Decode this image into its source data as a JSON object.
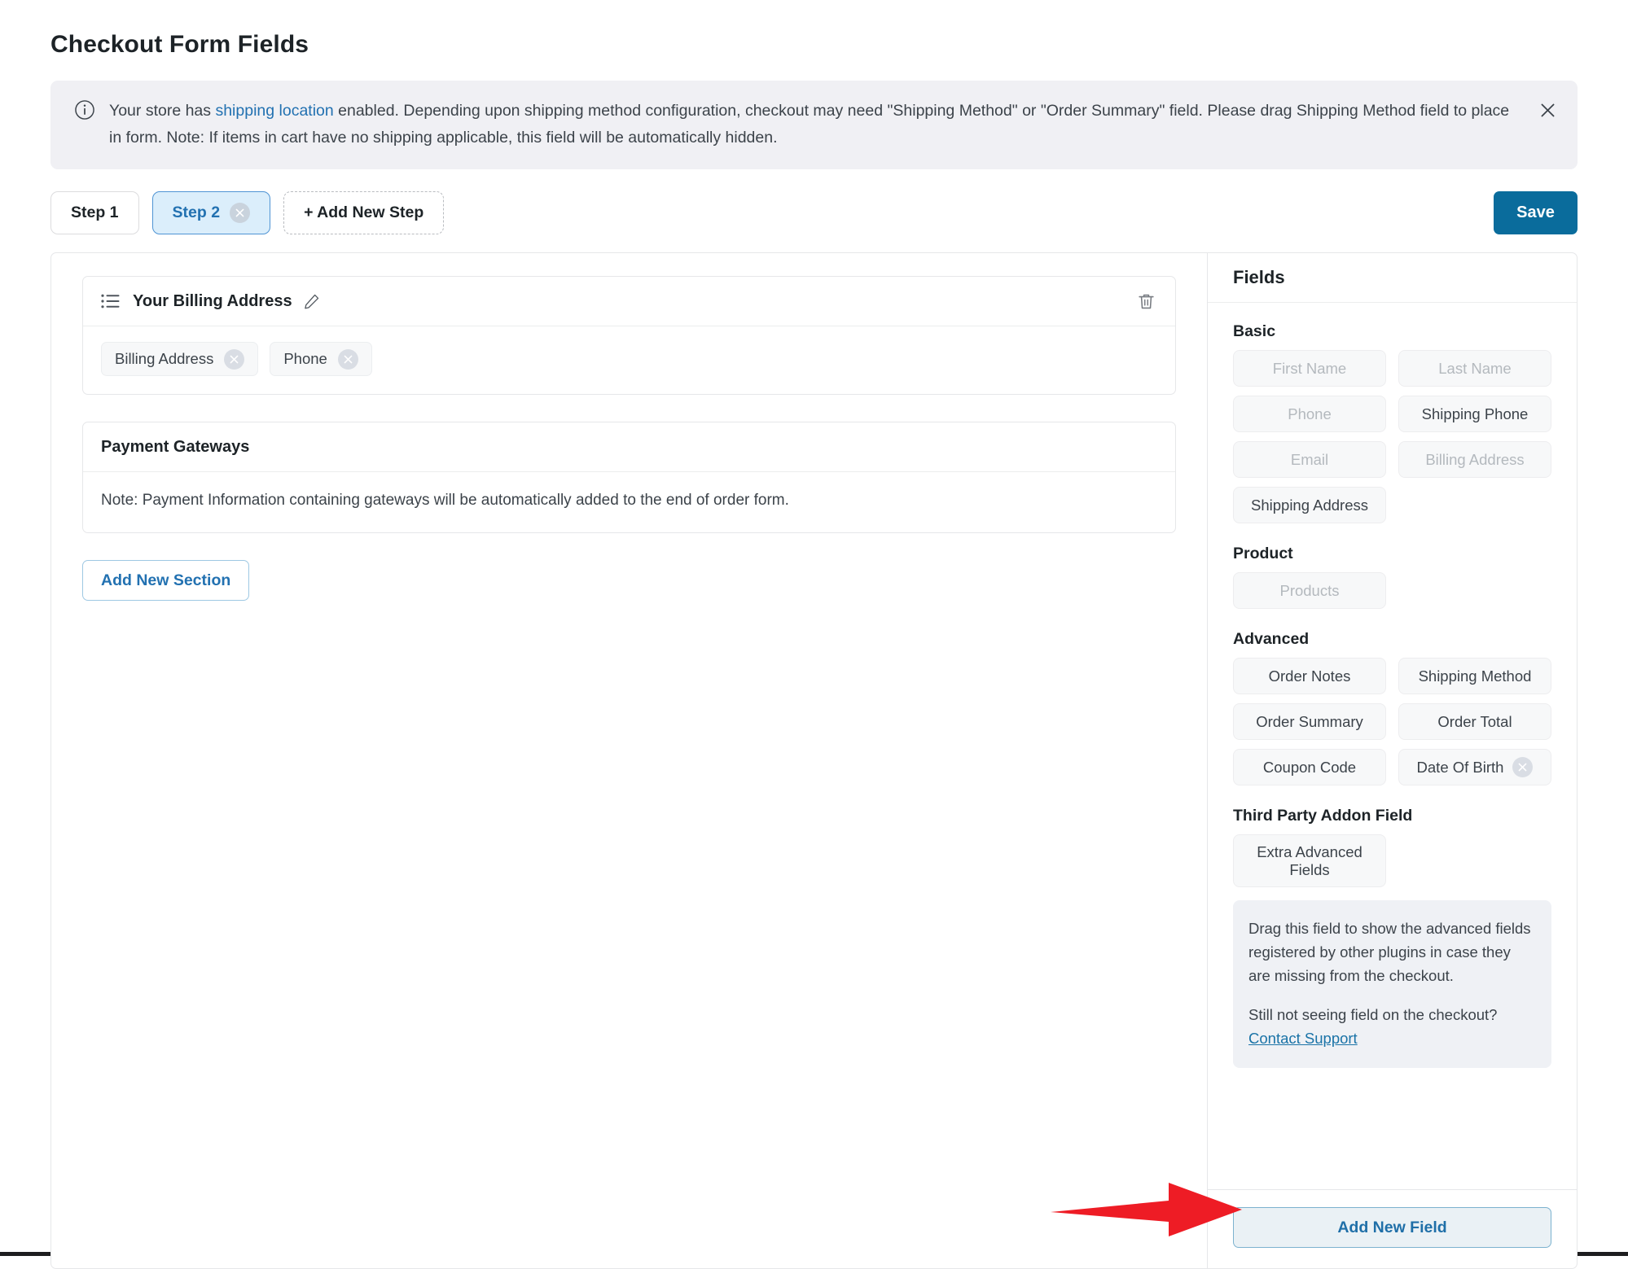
{
  "page": {
    "title": "Checkout Form Fields"
  },
  "notice": {
    "icon": "info-circle-icon",
    "text_before_link": "Your store has ",
    "link_text": "shipping location",
    "text_after_link": " enabled. Depending upon shipping method configuration, checkout may need \"Shipping Method\" or \"Order Summary\" field. Please drag Shipping Method field to place in form. Note: If items in cart have no shipping applicable, this field will be automatically hidden.",
    "close_icon": "close-icon"
  },
  "steps": {
    "tabs": [
      {
        "label": "Step 1",
        "active": false,
        "closable": false
      },
      {
        "label": "Step 2",
        "active": true,
        "closable": true
      }
    ],
    "add_step_label": "+ Add New Step",
    "save_label": "Save"
  },
  "builder": {
    "sections": [
      {
        "title": "Your Billing Address",
        "drag_icon": "list-drag-handle-icon",
        "edit_icon": "pencil-edit-icon",
        "delete_icon": "trash-icon",
        "fields": [
          {
            "label": "Billing Address",
            "removable": true
          },
          {
            "label": "Phone",
            "removable": true
          }
        ]
      }
    ],
    "payment_gateways": {
      "title": "Payment Gateways",
      "note": "Note: Payment Information containing gateways will be automatically added to the end of order form."
    },
    "add_section_label": "Add New Section"
  },
  "sidebar": {
    "heading": "Fields",
    "groups": [
      {
        "title": "Basic",
        "pills": [
          {
            "label": "First Name",
            "disabled": true,
            "removable": false
          },
          {
            "label": "Last Name",
            "disabled": true,
            "removable": false
          },
          {
            "label": "Phone",
            "disabled": true,
            "removable": false
          },
          {
            "label": "Shipping Phone",
            "disabled": false,
            "removable": false
          },
          {
            "label": "Email",
            "disabled": true,
            "removable": false
          },
          {
            "label": "Billing Address",
            "disabled": true,
            "removable": false
          },
          {
            "label": "Shipping Address",
            "disabled": false,
            "removable": false
          }
        ]
      },
      {
        "title": "Product",
        "pills": [
          {
            "label": "Products",
            "disabled": true,
            "removable": false
          }
        ]
      },
      {
        "title": "Advanced",
        "pills": [
          {
            "label": "Order Notes",
            "disabled": false,
            "removable": false
          },
          {
            "label": "Shipping Method",
            "disabled": false,
            "removable": false
          },
          {
            "label": "Order Summary",
            "disabled": false,
            "removable": false
          },
          {
            "label": "Order Total",
            "disabled": false,
            "removable": false
          },
          {
            "label": "Coupon Code",
            "disabled": false,
            "removable": false
          },
          {
            "label": "Date Of Birth",
            "disabled": false,
            "removable": true
          }
        ]
      },
      {
        "title": "Third Party Addon Field",
        "pills": [
          {
            "label": "Extra Advanced Fields",
            "disabled": false,
            "removable": false,
            "tall": true
          }
        ]
      }
    ],
    "addon_note": {
      "paragraph1": "Drag this field to show the advanced fields registered by other plugins in case they are missing from the checkout.",
      "paragraph2": "Still not seeing field on the checkout?",
      "link_text": "Contact Support"
    },
    "add_field_label": "Add New Field"
  },
  "annotation": {
    "type": "red-arrow",
    "color": "#ee1c25",
    "points_to": "Add New Field"
  }
}
